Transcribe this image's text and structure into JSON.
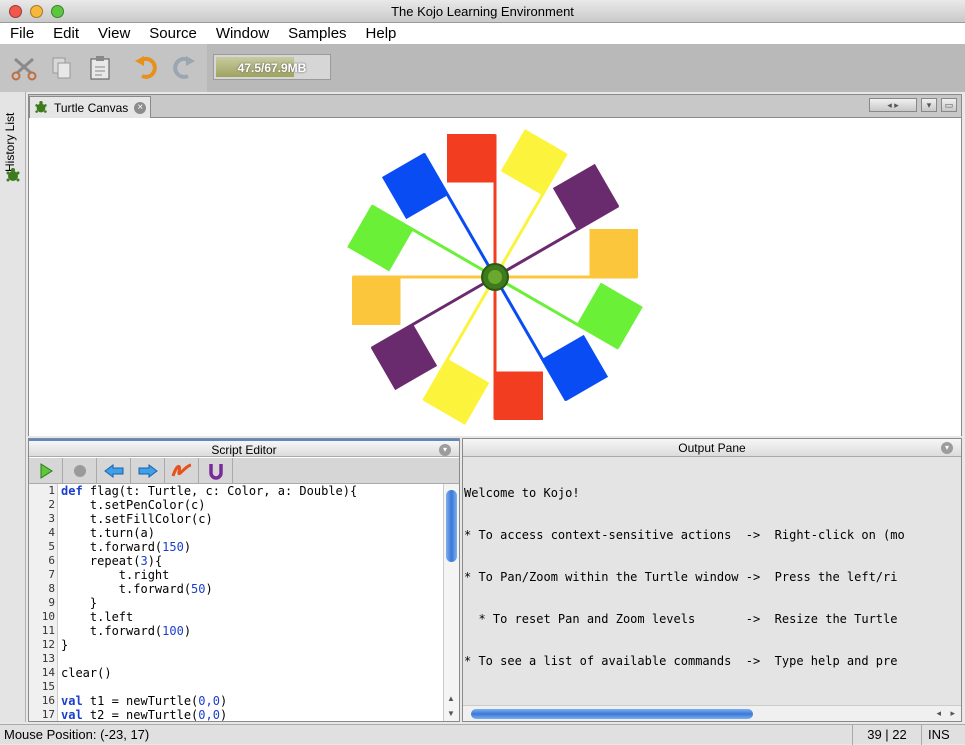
{
  "window": {
    "title": "The Kojo Learning Environment"
  },
  "menu": [
    "File",
    "Edit",
    "View",
    "Source",
    "Window",
    "Samples",
    "Help"
  ],
  "toolbar": {
    "memory": "47.5/67.9MB",
    "memory_fraction": 0.7
  },
  "sidebar": {
    "history_label": "History List"
  },
  "canvas": {
    "tab_label": "Turtle Canvas"
  },
  "script_editor": {
    "title": "Script Editor",
    "lines": [
      {
        "n": "1",
        "pre": "",
        "kw": "def",
        "rest": " flag(t: Turtle, c: Color, a: Double){"
      },
      {
        "n": "2",
        "pre": "    t.setPenColor(c)",
        "kw": "",
        "rest": ""
      },
      {
        "n": "3",
        "pre": "    t.setFillColor(c)",
        "kw": "",
        "rest": ""
      },
      {
        "n": "4",
        "pre": "    t.turn(a)",
        "kw": "",
        "rest": ""
      },
      {
        "n": "5",
        "pre": "    t.forward(",
        "kw": "",
        "num": "150",
        "rest": ")"
      },
      {
        "n": "6",
        "pre": "    repeat(",
        "kw": "",
        "num": "3",
        "rest": "){"
      },
      {
        "n": "7",
        "pre": "        t.right",
        "kw": "",
        "rest": ""
      },
      {
        "n": "8",
        "pre": "        t.forward(",
        "kw": "",
        "num": "50",
        "rest": ")"
      },
      {
        "n": "9",
        "pre": "    }",
        "kw": "",
        "rest": ""
      },
      {
        "n": "10",
        "pre": "    t.left",
        "kw": "",
        "rest": ""
      },
      {
        "n": "11",
        "pre": "    t.forward(",
        "kw": "",
        "num": "100",
        "rest": ")"
      },
      {
        "n": "12",
        "pre": "}",
        "kw": "",
        "rest": ""
      },
      {
        "n": "13",
        "pre": "",
        "kw": "",
        "rest": ""
      },
      {
        "n": "14",
        "pre": "clear()",
        "kw": "",
        "rest": ""
      },
      {
        "n": "15",
        "pre": "",
        "kw": "",
        "rest": ""
      },
      {
        "n": "16",
        "pre": "",
        "kw": "val",
        "rest": " t1 = newTurtle(",
        "num2": "0,0",
        "end": ")"
      },
      {
        "n": "17",
        "pre": "",
        "kw": "val",
        "rest": " t2 = newTurtle(",
        "num2": "0,0",
        "end": ")"
      }
    ]
  },
  "output": {
    "title": "Output Pane",
    "lines": [
      "Welcome to Kojo!",
      "* To access context-sensitive actions  ->  Right-click on (mo",
      "* To Pan/Zoom within the Turtle window ->  Press the left/ri",
      "  * To reset Pan and Zoom levels       ->  Resize the Turtle",
      "* To see a list of available commands  ->  Type help and pre",
      "                                          ______"
    ]
  },
  "status": {
    "mouse": "Mouse Position: (-23, 17)",
    "position": "39 | 22",
    "mode": "INS"
  },
  "colors": {
    "red": "#f23d21",
    "yellow": "#fcf43c",
    "purple": "#6a2a6e",
    "orange": "#fcc63c",
    "green": "#6af036",
    "blue": "#0a4cf4",
    "accent": "#3a78d8"
  }
}
